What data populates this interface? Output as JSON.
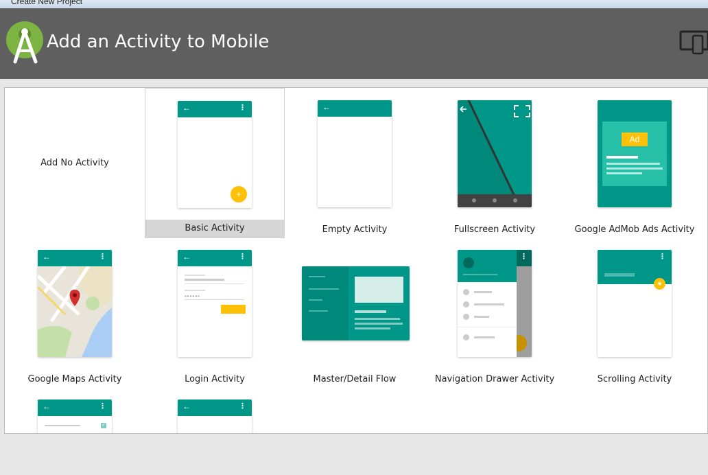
{
  "window": {
    "title": "Create New Project"
  },
  "header": {
    "title": "Add an Activity to Mobile"
  },
  "tiles": {
    "no_activity": "Add No Activity",
    "basic": "Basic Activity",
    "empty": "Empty Activity",
    "fullscreen": "Fullscreen Activity",
    "admob": "Google AdMob Ads Activity",
    "maps": "Google Maps Activity",
    "login": "Login Activity",
    "master_detail": "Master/Detail Flow",
    "nav_drawer": "Navigation Drawer Activity",
    "scrolling": "Scrolling Activity"
  },
  "thumb": {
    "ad_badge": "Ad"
  },
  "colors": {
    "teal": "#009688",
    "accent": "#FFC107",
    "header": "#5f5f5f"
  }
}
